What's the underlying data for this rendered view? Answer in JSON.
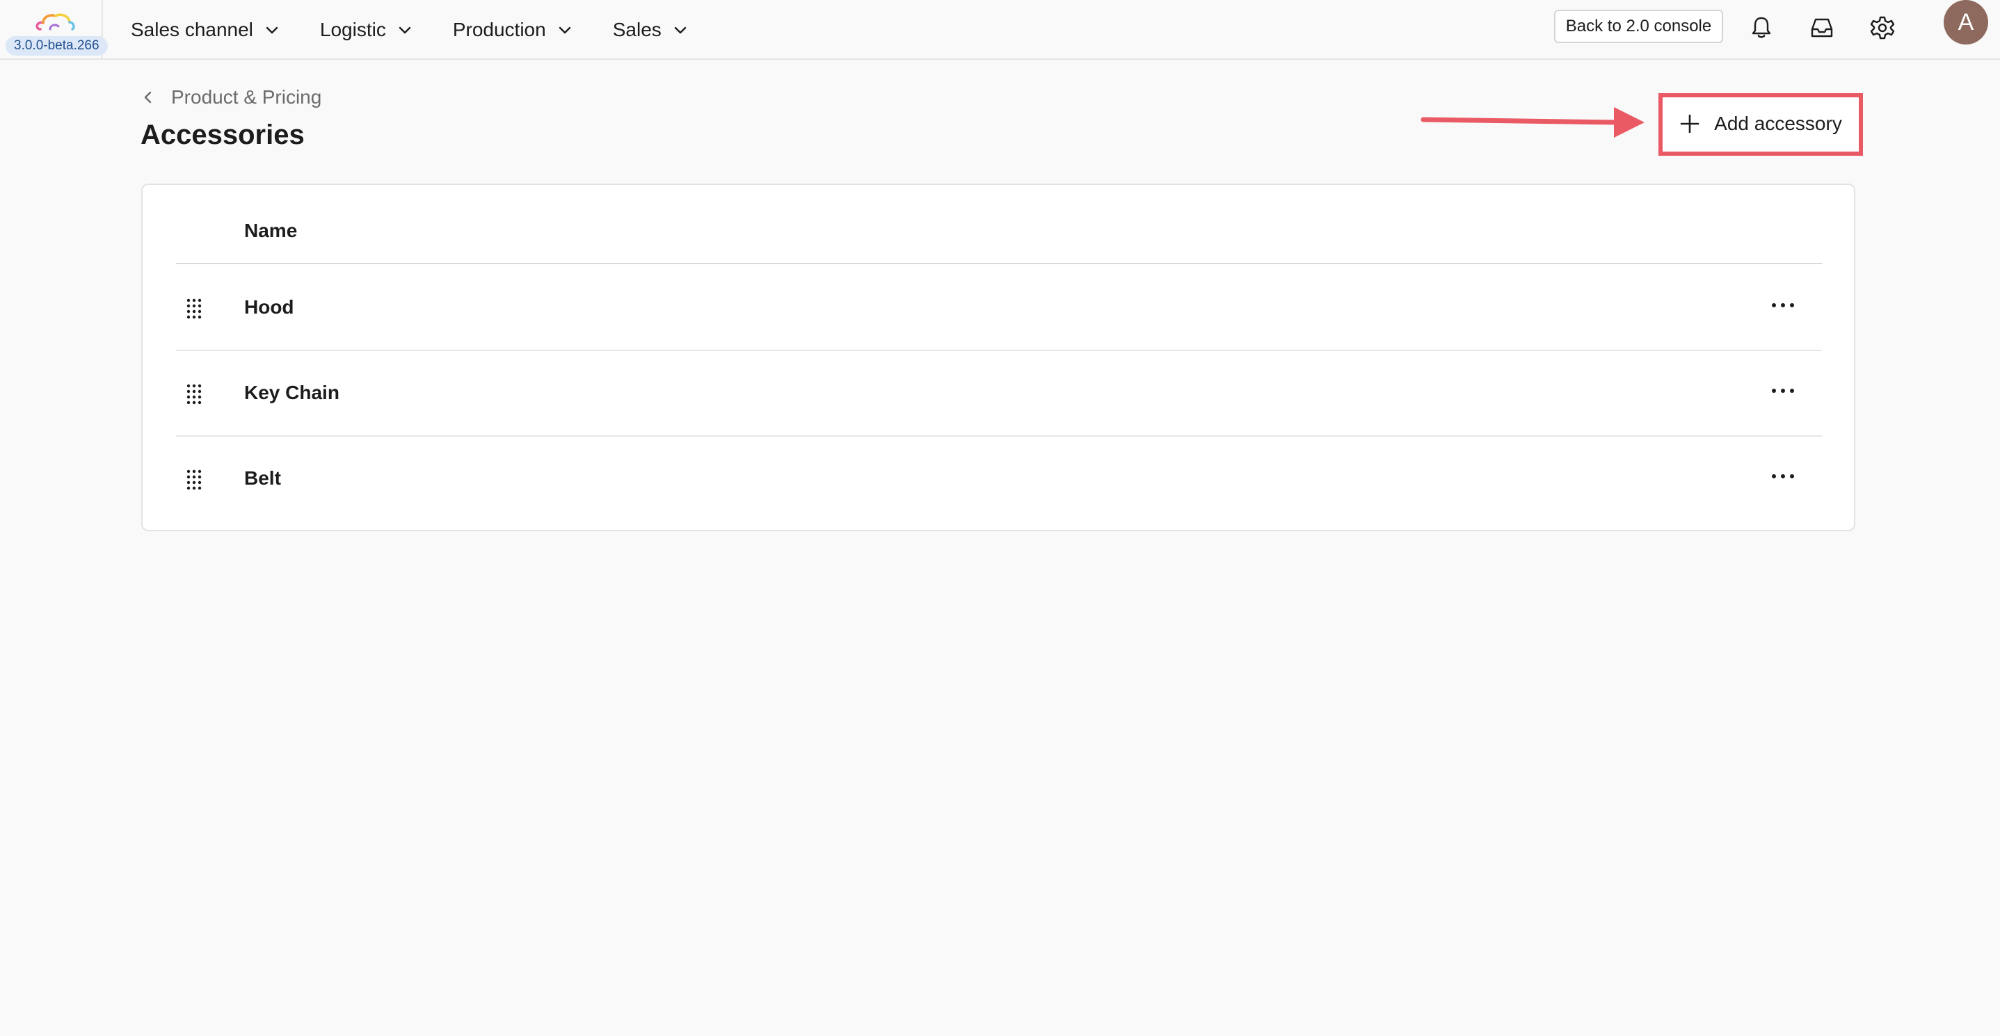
{
  "app": {
    "version": "3.0.0-beta.266"
  },
  "nav": {
    "items": [
      {
        "label": "Sales channel"
      },
      {
        "label": "Logistic"
      },
      {
        "label": "Production"
      },
      {
        "label": "Sales"
      }
    ],
    "back_button": "Back to 2.0 console",
    "avatar_initial": "A"
  },
  "icons": {
    "logo": "cloud-logo-icon",
    "notifications": "bell-icon",
    "inbox": "inbox-icon",
    "settings": "gear-icon",
    "drag_handle": "drag-handle-icon",
    "row_menu": "more-horizontal-icon",
    "add": "plus-icon",
    "back": "chevron-left-icon"
  },
  "page": {
    "breadcrumb": "Product & Pricing",
    "title": "Accessories",
    "add_button": "Add accessory"
  },
  "table": {
    "columns": [
      "Name"
    ],
    "rows": [
      {
        "name": "Hood"
      },
      {
        "name": "Key Chain"
      },
      {
        "name": "Belt"
      }
    ]
  },
  "colors": {
    "highlight": "#ea5a64",
    "avatar": "#8e6a5e",
    "version_badge_bg": "#dce8f7"
  }
}
